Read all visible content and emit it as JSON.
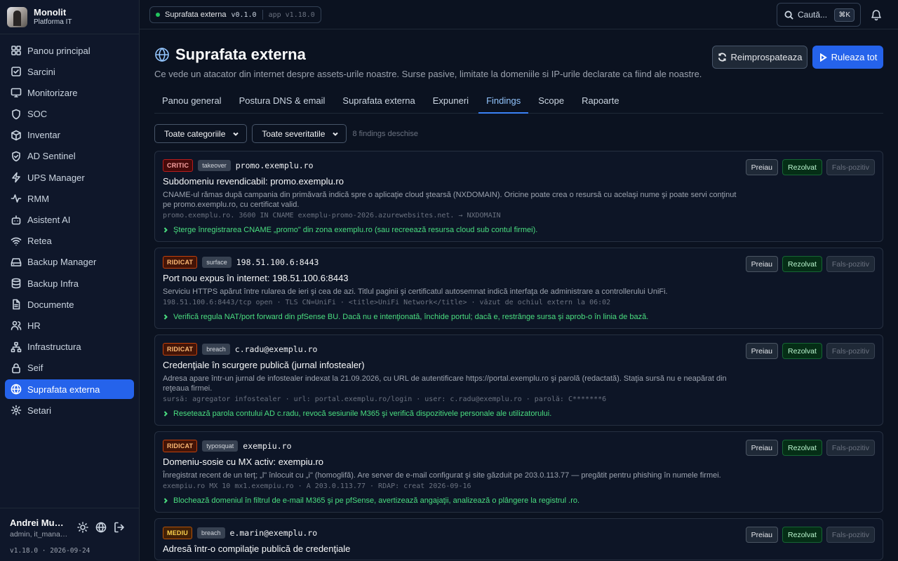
{
  "brand": {
    "name": "Monolit",
    "subtitle": "Platforma IT"
  },
  "sidebar": {
    "items": [
      {
        "label": "Panou principal",
        "icon": "dashboard-icon"
      },
      {
        "label": "Sarcini",
        "icon": "check-square-icon"
      },
      {
        "label": "Monitorizare",
        "icon": "monitor-icon"
      },
      {
        "label": "SOC",
        "icon": "shield-icon"
      },
      {
        "label": "Inventar",
        "icon": "box-icon"
      },
      {
        "label": "AD Sentinel",
        "icon": "shield-check-icon"
      },
      {
        "label": "UPS Manager",
        "icon": "zap-icon"
      },
      {
        "label": "RMM",
        "icon": "activity-icon"
      },
      {
        "label": "Asistent AI",
        "icon": "bot-icon"
      },
      {
        "label": "Retea",
        "icon": "wifi-icon"
      },
      {
        "label": "Backup Manager",
        "icon": "hard-drive-icon"
      },
      {
        "label": "Backup Infra",
        "icon": "database-icon"
      },
      {
        "label": "Documente",
        "icon": "file-icon"
      },
      {
        "label": "HR",
        "icon": "users-icon"
      },
      {
        "label": "Infrastructura",
        "icon": "network-icon"
      },
      {
        "label": "Seif",
        "icon": "lock-icon"
      },
      {
        "label": "Suprafata externa",
        "icon": "globe-icon",
        "active": true
      },
      {
        "label": "Setari",
        "icon": "gear-icon"
      }
    ]
  },
  "user": {
    "name": "Andrei Munteanu",
    "role": "admin, it_manager",
    "version": "v1.18.0 · 2026-09-24"
  },
  "topbar": {
    "module": "Suprafata externa",
    "module_version": "v0.1.0",
    "app_version": "app v1.18.0",
    "search_placeholder": "Caută...",
    "search_shortcut": "⌘K"
  },
  "header": {
    "title": "Suprafata externa",
    "subtitle": "Ce vede un atacator din internet despre assets-urile noastre. Surse pasive, limitate la domeniile si IP-urile declarate ca fiind ale noastre.",
    "refresh_label": "Reimprospateaza",
    "run_label": "Ruleaza tot"
  },
  "tabs": [
    {
      "label": "Panou general"
    },
    {
      "label": "Postura DNS & email"
    },
    {
      "label": "Suprafata externa"
    },
    {
      "label": "Expuneri"
    },
    {
      "label": "Findings",
      "active": true
    },
    {
      "label": "Scope"
    },
    {
      "label": "Rapoarte"
    }
  ],
  "filters": {
    "category": "Toate categoriile",
    "severity": "Toate severitatile",
    "count_text": "8 findings deschise"
  },
  "actions": {
    "take": "Preiau",
    "resolve": "Rezolvat",
    "false_positive": "Fals-pozitiv"
  },
  "findings": [
    {
      "severity": "CRITIC",
      "sev_class": "critic",
      "category": "takeover",
      "target": "promo.exemplu.ro",
      "title": "Subdomeniu revendicabil: promo.exemplu.ro",
      "description": "CNAME-ul rămas după campania din primăvară indică spre o aplicaţie cloud ştearsă (NXDOMAIN). Oricine poate crea o resursă cu acelaşi nume şi poate servi conţinut pe promo.exemplu.ro, cu certificat valid.",
      "evidence": "promo.exemplu.ro. 3600 IN CNAME exemplu-promo-2026.azurewebsites.net. → NXDOMAIN",
      "fix": "Şterge înregistrarea CNAME „promo\" din zona exemplu.ro (sau recreează resursa cloud sub contul firmei)."
    },
    {
      "severity": "RIDICAT",
      "sev_class": "ridicat",
      "category": "surface",
      "target": "198.51.100.6:8443",
      "title": "Port nou expus în internet: 198.51.100.6:8443",
      "description": "Serviciu HTTPS apărut între rularea de ieri şi cea de azi. Titlul paginii şi certificatul autosemnat indică interfaţa de administrare a controllerului UniFi.",
      "evidence": "198.51.100.6:8443/tcp open · TLS CN=UniFi · <title>UniFi Network</title> · văzut de ochiul extern la 06:02",
      "fix": "Verifică regula NAT/port forward din pfSense BU. Dacă nu e intenţionată, închide portul; dacă e, restrânge sursa şi aprob-o în linia de bază."
    },
    {
      "severity": "RIDICAT",
      "sev_class": "ridicat",
      "category": "breach",
      "target": "c.radu@exemplu.ro",
      "title": "Credenţiale în scurgere publică (jurnal infostealer)",
      "description": "Adresa apare într-un jurnal de infostealer indexat la 21.09.2026, cu URL de autentificare https://portal.exemplu.ro şi parolă (redactată). Staţia sursă nu e neapărat din reţeaua firmei.",
      "evidence": "sursă: agregator infostealer · url: portal.exemplu.ro/login · user: c.radu@exemplu.ro · parolă: C*******6",
      "fix": "Resetează parola contului AD c.radu, revocă sesiunile M365 şi verifică dispozitivele personale ale utilizatorului."
    },
    {
      "severity": "RIDICAT",
      "sev_class": "ridicat",
      "category": "typosquat",
      "target": "exempiu.ro",
      "title": "Domeniu-sosie cu MX activ: exempiu.ro",
      "description": "Înregistrat recent de un terţ; „l\" înlocuit cu „i\" (homoglifă). Are server de e-mail configurat şi site găzduit pe 203.0.113.77 — pregătit pentru phishing în numele firmei.",
      "evidence": "exempiu.ro MX 10 mx1.exempiu.ro · A 203.0.113.77 · RDAP: creat 2026-09-16",
      "fix": "Blochează domeniul în filtrul de e-mail M365 şi pe pfSense, avertizează angajaţii, analizează o plângere la registrul .ro."
    },
    {
      "severity": "MEDIU",
      "sev_class": "mediu",
      "category": "breach",
      "target": "e.marin@exemplu.ro",
      "title": "Adresă într-o compilaţie publică de credenţiale",
      "description": "",
      "evidence": "",
      "fix": ""
    }
  ]
}
